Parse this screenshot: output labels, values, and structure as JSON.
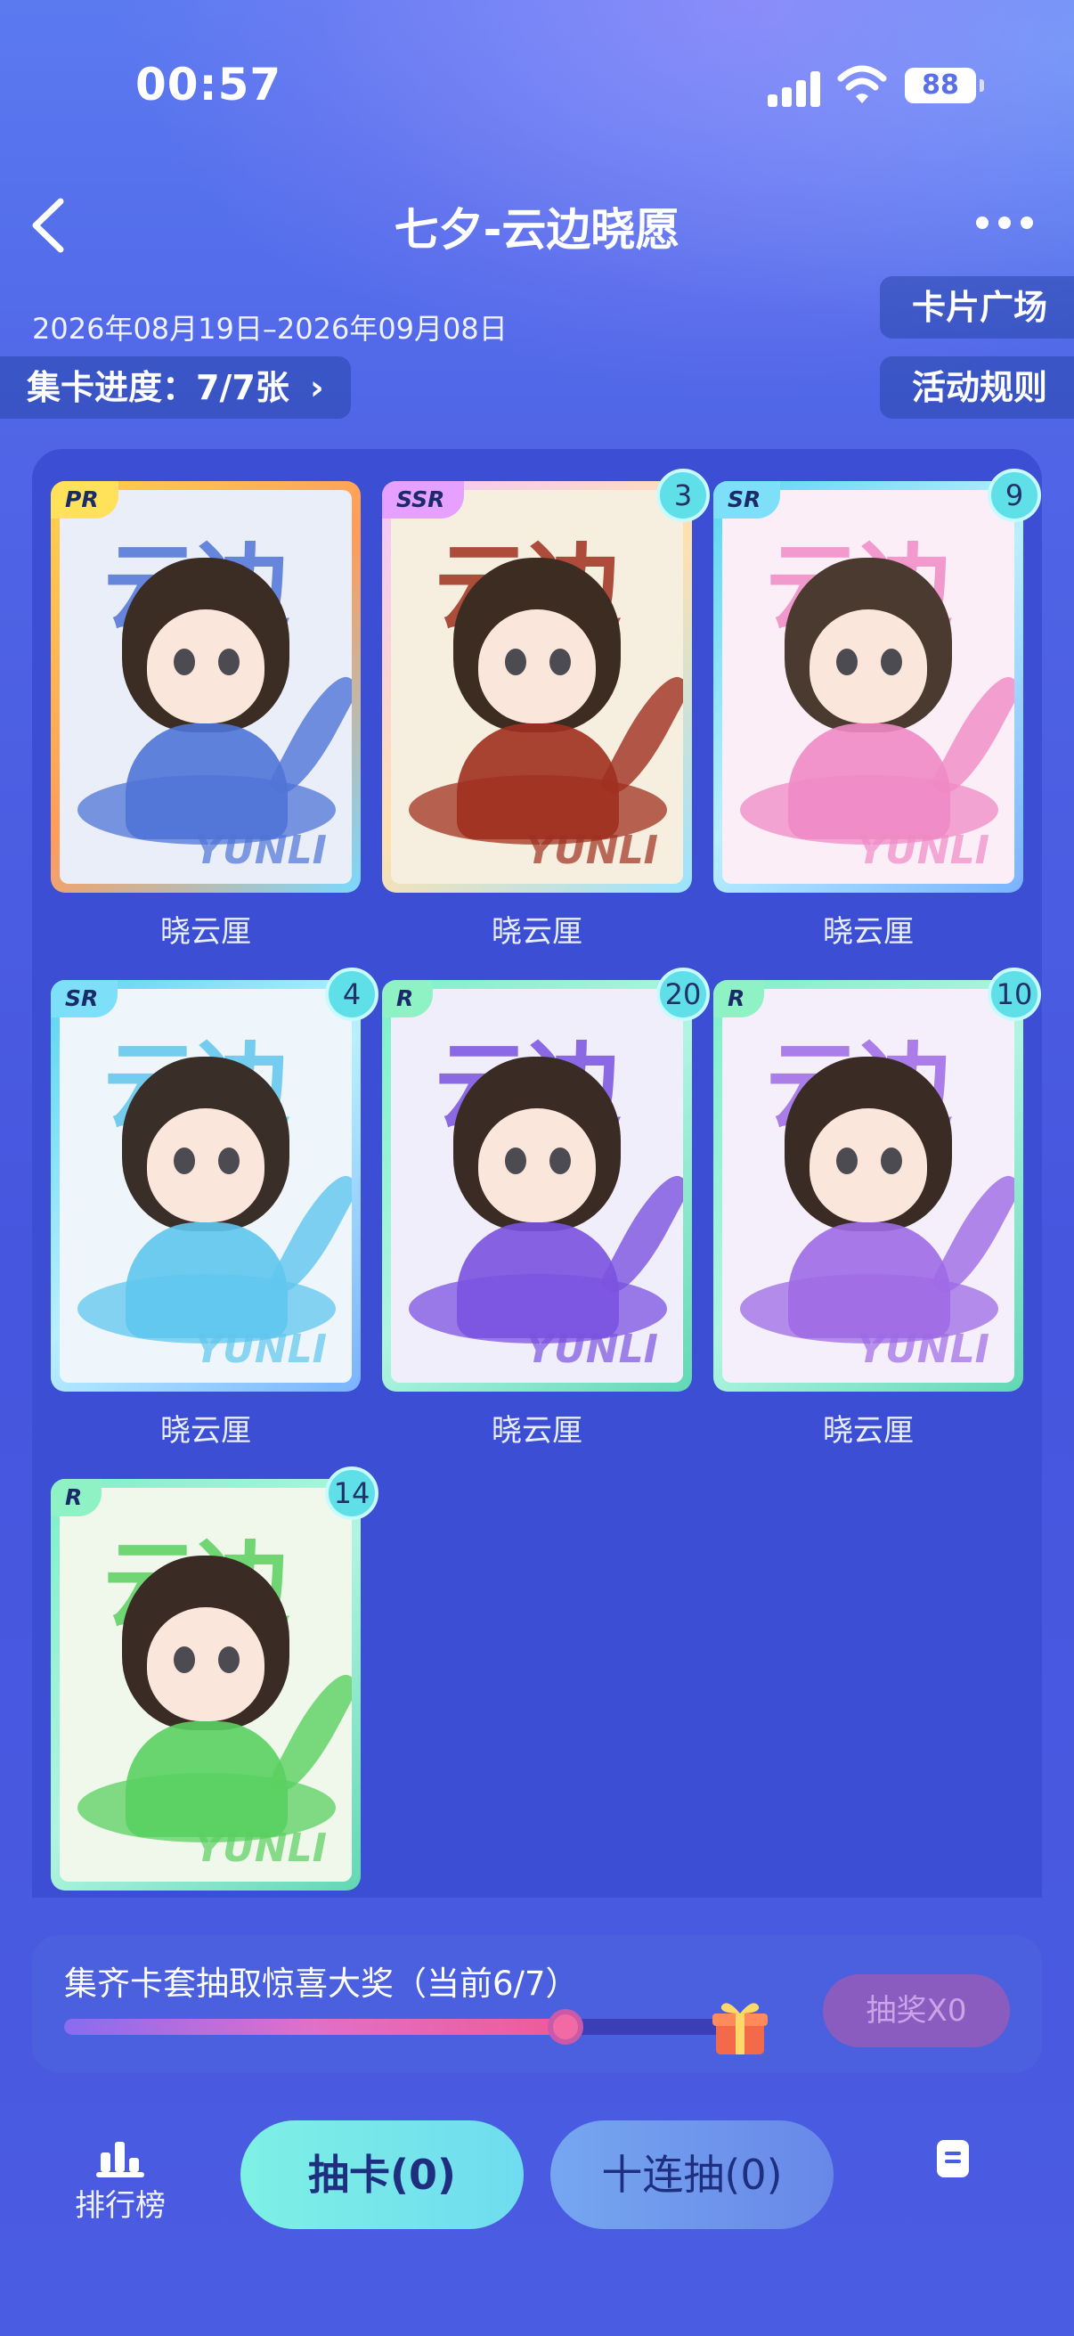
{
  "status_bar": {
    "time": "00:57",
    "battery": "88"
  },
  "header": {
    "title": "七夕-云边晓愿"
  },
  "event": {
    "date_range": "2026年08月19日–2026年09月08日",
    "progress": "集卡进度：7/7张",
    "progress_chevron": "›",
    "card_plaza": "卡片广场",
    "rules": "活动规则"
  },
  "cards": [
    {
      "rarity": "PR",
      "name": "晓云厘",
      "count": "",
      "theme": "#4f74d8",
      "frame": "linear-gradient(135deg,#ffd34a,#ff9c5a,#7ad8ff)",
      "rarity_bg": "#ffe15a",
      "bg": "#e9eef8",
      "hair": "#3b2c24"
    },
    {
      "rarity": "SSR",
      "name": "晓云厘",
      "count": "3",
      "theme": "#a0301f",
      "frame": "linear-gradient(135deg,#f3c6ff,#ffe1b0,#9ae3ff)",
      "rarity_bg": "#e6a0ff",
      "bg": "#f6eede",
      "hair": "#3d2c22"
    },
    {
      "rarity": "SR",
      "name": "晓云厘",
      "count": "9",
      "theme": "#f08ac6",
      "frame": "linear-gradient(135deg,#5ad6f0,#b8f0ff,#7ab2ff)",
      "rarity_bg": "#7ee0f8",
      "bg": "#fbeef6",
      "hair": "#4a3a30"
    },
    {
      "rarity": "SR",
      "name": "晓云厘",
      "count": "4",
      "theme": "#5fc6ee",
      "frame": "linear-gradient(135deg,#5ad6f0,#b8f0ff,#7ab2ff)",
      "rarity_bg": "#7ee0f8",
      "bg": "#eef6fb",
      "hair": "#3a2e28"
    },
    {
      "rarity": "R",
      "name": "晓云厘",
      "count": "20",
      "theme": "#7a52e0",
      "frame": "linear-gradient(135deg,#7ef0c8,#b0f5e0,#62d8b4)",
      "rarity_bg": "#8ef2c4",
      "bg": "#f1eefb",
      "hair": "#3a2b24"
    },
    {
      "rarity": "R",
      "name": "晓云厘",
      "count": "10",
      "theme": "#9e6ae6",
      "frame": "linear-gradient(135deg,#7ef0c8,#b0f5e0,#62d8b4)",
      "rarity_bg": "#8ef2c4",
      "bg": "#f4effb",
      "hair": "#3a2b24"
    },
    {
      "rarity": "R",
      "name": "",
      "count": "14",
      "theme": "#5ad060",
      "frame": "linear-gradient(135deg,#7ef0c8,#b0f5e0,#62d8b4)",
      "rarity_bg": "#8ef2c4",
      "bg": "#f0f8ec",
      "hair": "#3a2b24"
    }
  ],
  "card_art": {
    "big_text": "云边",
    "signature": "YUNLI"
  },
  "prize": {
    "text": "集齐卡套抽取惊喜大奖（当前6/7）",
    "progress": 0.857,
    "button": "抽奖X0"
  },
  "bottom": {
    "rank_label": "排行榜",
    "draw_one": "抽卡(0)",
    "draw_ten": "十连抽(0)"
  }
}
